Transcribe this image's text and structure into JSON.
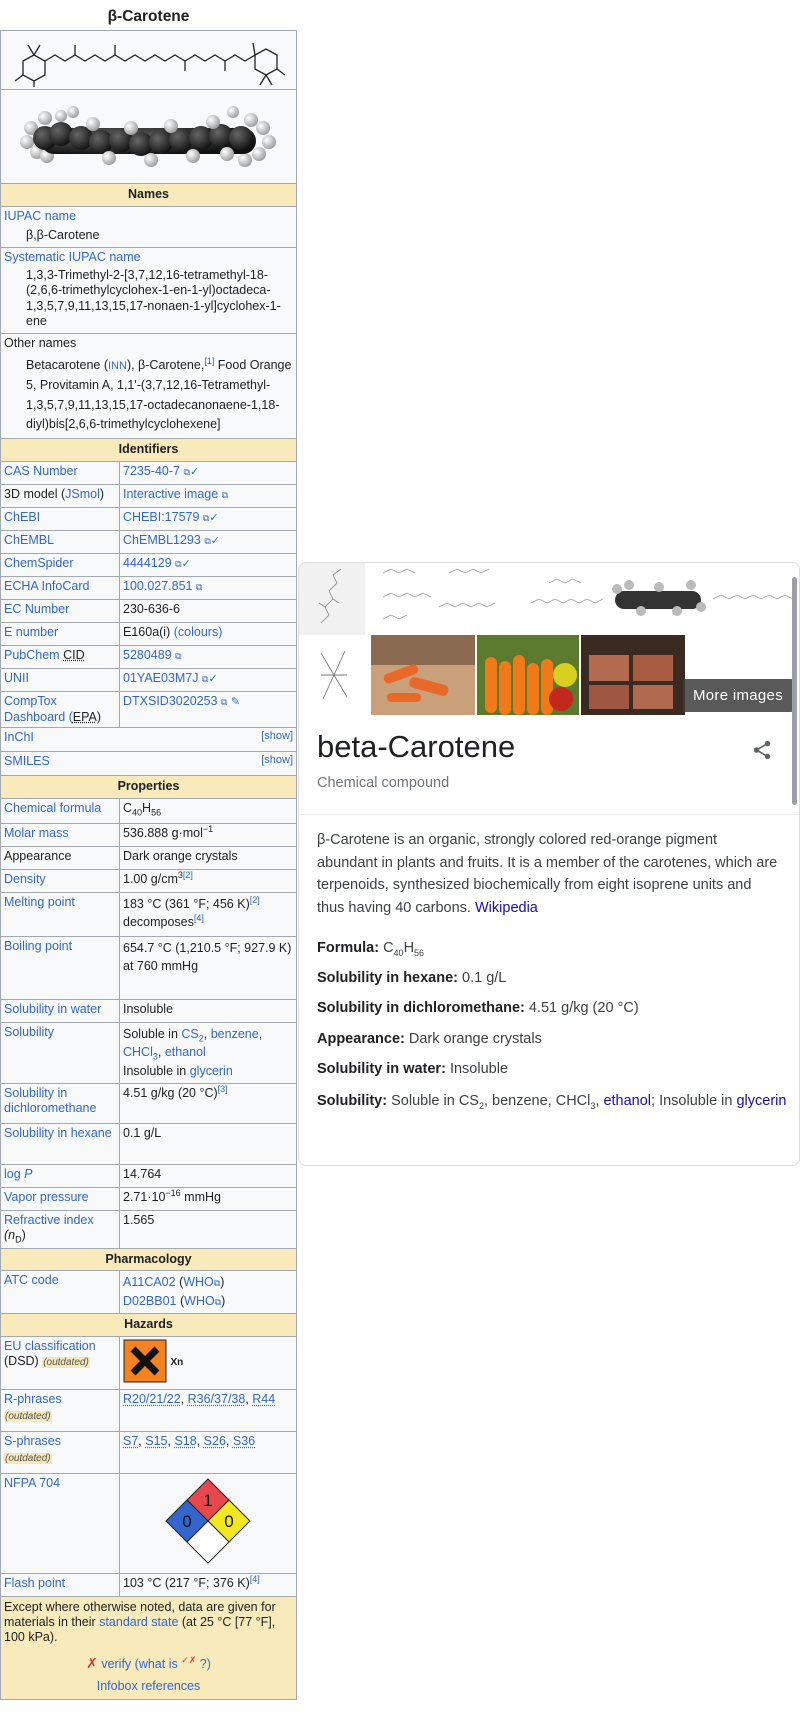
{
  "infobox": {
    "title": "β-Carotene",
    "sections": {
      "names": "Names",
      "identifiers": "Identifiers",
      "properties": "Properties",
      "pharmacology": "Pharmacology",
      "hazards": "Hazards"
    },
    "iupac_label": "IUPAC name",
    "iupac_value": "β,β-Carotene",
    "sys_label": "Systematic IUPAC name",
    "sys_value": "1,3,3-Trimethyl-2-[3,7,12,16-tetramethyl-18-(2,6,6-trimethylcyclohex-1-en-1-yl)octadeca-1,3,5,7,9,11,13,15,17-nonaen-1-yl]cyclohex-1-ene",
    "other_label": "Other names",
    "other_pre": "Betacarotene (",
    "other_inn": "INN",
    "other_mid": "), β-Carotene,",
    "other_ref": "[1]",
    "other_post": " Food Orange 5, Provitamin A, 1,1'-(3,7,12,16-Tetramethyl-1,3,5,7,9,11,13,15,17-octadecanonaene-1,18-diyl)bis[2,6,6-trimethylcyclohexene]",
    "identifiers": {
      "cas_k": "CAS Number",
      "cas_v": "7235-40-7",
      "jsmol_k1": "3D model (",
      "jsmol_k2": "JSmol",
      "jsmol_k3": ")",
      "jsmol_v": "Interactive image",
      "chebi_k": "ChEBI",
      "chebi_v": "CHEBI:17579",
      "chembl_k": "ChEMBL",
      "chembl_v": "ChEMBL1293",
      "chemspider_k": "ChemSpider",
      "chemspider_v": "4444129",
      "echa_k": "ECHA InfoCard",
      "echa_v": "100.027.851",
      "ec_k": "EC Number",
      "ec_v": "230-636-6",
      "enum_k": "E number",
      "enum_v": "E160a(i) ",
      "enum_link": "(colours)",
      "pubchem_k1": "PubChem ",
      "pubchem_k2": "CID",
      "pubchem_v": "5280489",
      "unii_k": "UNII",
      "unii_v": "01YAE03M7J",
      "comptox_k1": "CompTox Dashboard (",
      "comptox_k2": "EPA",
      "comptox_k3": ")",
      "comptox_v": "DTXSID3020253",
      "inchi_k": "InChI",
      "smiles_k": "SMILES",
      "show": "[show]"
    },
    "properties": {
      "formula_k": "Chemical formula",
      "molar_k": "Molar mass",
      "molar_v1": "536.888 g·mol",
      "molar_sup": "−1",
      "appear_k": "Appearance",
      "appear_v": "Dark orange crystals",
      "density_k": "Density",
      "density_v": "1.00 g/cm",
      "density_sup": "3",
      "density_ref": "[2]",
      "melt_k": "Melting point",
      "melt_v": "183 °C (361 °F; 456 K)",
      "melt_ref": "[2]",
      "melt_v2": "decomposes",
      "melt_ref2": "[4]",
      "boil_k": "Boiling point",
      "boil_v": "654.7 °C (1,210.5 °F; 927.9 K)",
      "boil_v2": "at 760 mmHg",
      "solw_k": "Solubility in water",
      "solw_v": "Insoluble",
      "sol_k": "Solubility",
      "sol_v1": "Soluble in ",
      "sol_cs": "CS",
      "sol_sub2": "2",
      "sol_comma": ", ",
      "sol_benz": "benzene",
      "sol_chcl": "CHCl",
      "sol_sub3": "3",
      "sol_eth": "ethanol",
      "sol_v2": "Insoluble in ",
      "sol_gly": "glycerin",
      "soldcm_k": "Solubility in dichloromethane",
      "soldcm_v": "4.51 g/kg (20 °C)",
      "soldcm_ref": "[3]",
      "solhex_k": "Solubility in hexane",
      "solhex_v": "0.1 g/L",
      "logp_k1": "log ",
      "logp_k2": "P",
      "logp_v": "14.764",
      "vap_k": "Vapor pressure",
      "vap_v1": "2.71·10",
      "vap_sup": "−16",
      "vap_v2": " mmHg",
      "refr_k1": "Refractive index",
      "refr_k2": "(n",
      "refr_sub": "D",
      "refr_k3": ")",
      "refr_v": "1.565"
    },
    "pharm": {
      "atc_k": "ATC code",
      "atc1": "A11CA02",
      "atc2": "D02BB01",
      "who": "WHO"
    },
    "hazards": {
      "eu_k1": "EU classification",
      "eu_k2": "(DSD) ",
      "outdated": "(outdated)",
      "xn": "Xn",
      "r_k": "R-phrases",
      "r_v": [
        "R20/21/22",
        "R36/37/38",
        "R44"
      ],
      "s_k": "S-phrases",
      "s_v": [
        "S7",
        "S15",
        "S18",
        "S26",
        "S36"
      ],
      "nfpa_k": "NFPA 704",
      "nfpa": {
        "health": "0",
        "fire": "1",
        "reactivity": "0"
      },
      "flash_k": "Flash point",
      "flash_v": "103 °C (217 °F; 376 K)",
      "flash_ref": "[4]"
    },
    "footer": {
      "text1": "Except where otherwise noted, data are given for materials in their ",
      "std_link": "standard state",
      "text2": " (at 25 °C [77 °F], 100 kPa).",
      "x_mark": "✗",
      "verify": "verify",
      "what_is": " (what is ",
      "checkx": "✓✗",
      "q": " ?)",
      "refs": "Infobox references"
    }
  },
  "panel": {
    "more_images": "More images",
    "title": "beta-Carotene",
    "subtitle": "Chemical compound",
    "description": "β-Carotene is an organic, strongly colored red-orange pigment abundant in plants and fruits. It is a member of the carotenes, which are terpenoids, synthesized biochemically from eight isoprene units and thus having 40 carbons. ",
    "wiki_link": "Wikipedia",
    "facts": {
      "formula_k": "Formula: ",
      "solhex_k": "Solubility in hexane: ",
      "solhex_v": "0.1 g/L",
      "soldcm_k": "Solubility in dichloromethane: ",
      "soldcm_v": "4.51 g/kg (20 °C)",
      "appear_k": "Appearance: ",
      "appear_v": "Dark orange crystals",
      "solw_k": "Solubility in water: ",
      "solw_v": "Insoluble",
      "sol_k": "Solubility: ",
      "sol_v1": "Soluble in CS",
      "sol_sub": "2",
      "sol_v2": ", benzene, CHCl",
      "sol_sub2": "3",
      "sol_v3": ", ",
      "sol_eth": "ethanol",
      "sol_v4": "; Insoluble in ",
      "sol_gly": "glycerin"
    },
    "formula": {
      "c": "C",
      "c_n": "40",
      "h": "H",
      "h_n": "56"
    }
  },
  "colors": {
    "link": "#3366cc",
    "header": "#f8eaba",
    "nfpa_health": "#3366cc",
    "nfpa_fire": "#e8474b",
    "nfpa_react": "#f2e81f"
  }
}
